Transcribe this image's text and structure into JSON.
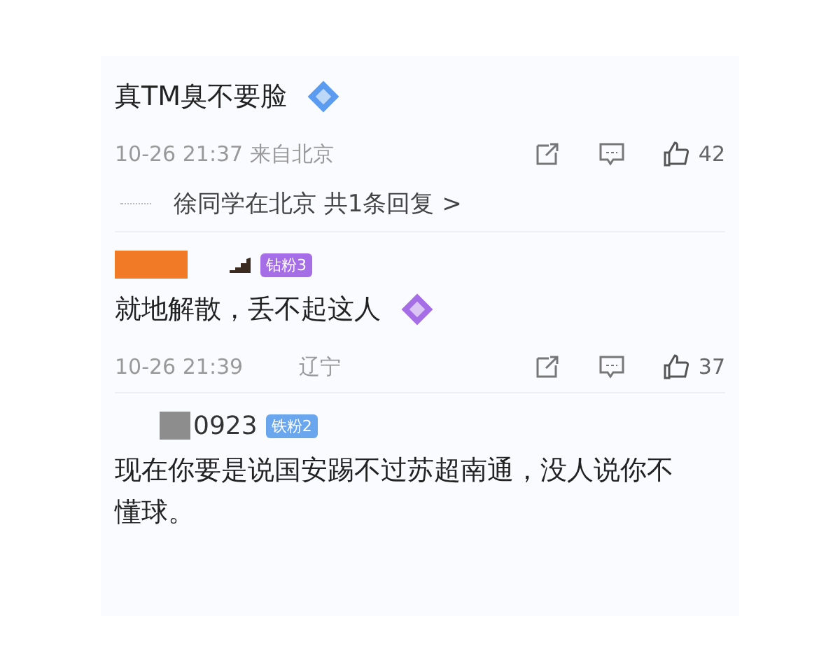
{
  "comments": [
    {
      "text": "真TM臭不要脸",
      "sticker": {
        "color": "#5b9cf0"
      },
      "time": "10-26 21:37 来自北京",
      "likes": "42",
      "reply_summary": "徐同学在北京 共1条回复 >"
    },
    {
      "redaction": {
        "color": "#f07a26"
      },
      "badge": {
        "label": "钻粉3",
        "color": "#a66ee6"
      },
      "text": "就地解散，丢不起这人",
      "sticker": {
        "color": "#a66ee6"
      },
      "time": "10-26 21:39",
      "location": "辽宁",
      "likes": "37"
    },
    {
      "redaction": {
        "color": "#8d8d8d"
      },
      "name": "0923",
      "badge": {
        "label": "铁粉2",
        "color": "#6aa6ee"
      },
      "text": "现在你要是说国安踢不过苏超南通，没人说你不懂球。"
    }
  ]
}
